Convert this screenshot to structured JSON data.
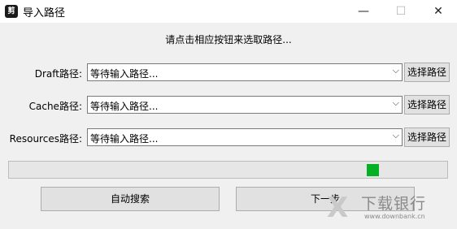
{
  "window": {
    "title": "导入路径",
    "icon": "app-logo-icon",
    "controls": {
      "minimize": "—",
      "maximize": "☐",
      "close": "✕"
    }
  },
  "instruction": "请点击相应按钮来选取路径...",
  "rows": [
    {
      "label": "Draft路径:",
      "value": "等待输入路径...",
      "button": "选择路径"
    },
    {
      "label": "Cache路径:",
      "value": "等待输入路径...",
      "button": "选择路径"
    },
    {
      "label": "Resources路径:",
      "value": "等待输入路径...",
      "button": "选择路径"
    }
  ],
  "progress": {
    "status_color": "#06b025"
  },
  "buttons": {
    "auto_search": "自动搜索",
    "next": "下一步"
  },
  "watermark": {
    "text": "下载银行",
    "url": "www.downbank.cn"
  }
}
